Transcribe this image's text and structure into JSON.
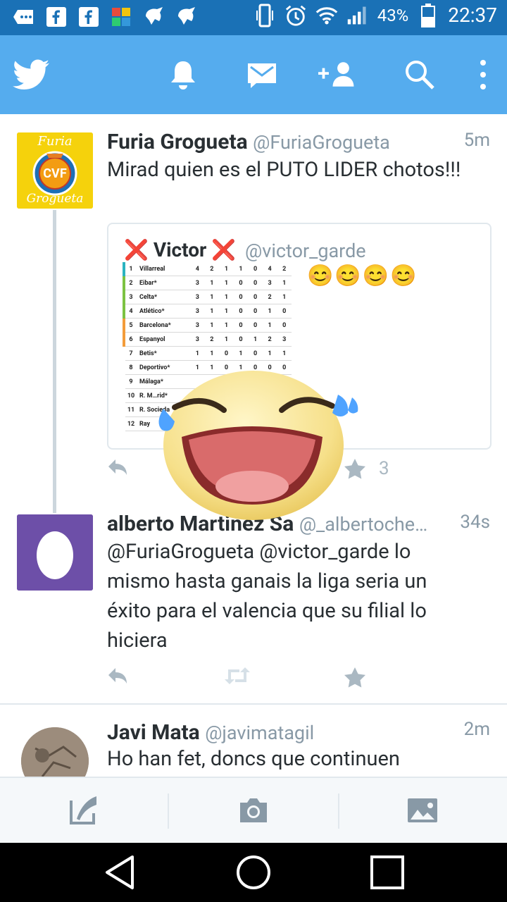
{
  "status_bar": {
    "battery": "43%",
    "time": "22:37"
  },
  "tweets": [
    {
      "name": "Furia Grogueta",
      "handle": "@FuriaGrogueta",
      "time": "5m",
      "text": "Mirad quien es el PUTO LIDER chotos!!!",
      "avatar_text_top": "Furia",
      "avatar_text_bottom": "Grogueta",
      "avatar_badge": "CVF",
      "favorites": "3",
      "quoted": {
        "name": "Victor",
        "handle": "@victor_garde",
        "emojis": "😊😊😊😊",
        "table": [
          {
            "pos": "1",
            "team": "Villarreal",
            "cols": [
              "4",
              "2",
              "1",
              "1",
              "0",
              "4",
              "2"
            ],
            "color": "#2bb3c0"
          },
          {
            "pos": "2",
            "team": "Eibar*",
            "cols": [
              "3",
              "1",
              "1",
              "0",
              "0",
              "3",
              "1"
            ],
            "color": "#7cc242"
          },
          {
            "pos": "3",
            "team": "Celta*",
            "cols": [
              "3",
              "1",
              "1",
              "0",
              "0",
              "2",
              "1"
            ],
            "color": "#7cc242"
          },
          {
            "pos": "4",
            "team": "Atlético*",
            "cols": [
              "3",
              "1",
              "1",
              "0",
              "0",
              "1",
              "0"
            ],
            "color": "#7cc242"
          },
          {
            "pos": "5",
            "team": "Barcelona*",
            "cols": [
              "3",
              "1",
              "1",
              "0",
              "0",
              "1",
              "0"
            ],
            "color": "#f39c3a"
          },
          {
            "pos": "6",
            "team": "Espanyol",
            "cols": [
              "3",
              "2",
              "1",
              "0",
              "1",
              "2",
              "3"
            ],
            "color": "#f39c3a"
          },
          {
            "pos": "7",
            "team": "Betis*",
            "cols": [
              "1",
              "1",
              "0",
              "1",
              "0",
              "1",
              "1"
            ],
            "color": "transparent"
          },
          {
            "pos": "8",
            "team": "Deportivo*",
            "cols": [
              "1",
              "1",
              "0",
              "1",
              "0",
              "0",
              "0"
            ],
            "color": "transparent"
          },
          {
            "pos": "9",
            "team": "Málaga*",
            "cols": [
              "",
              "",
              "",
              "",
              "",
              "",
              ""
            ],
            "color": "transparent"
          },
          {
            "pos": "10",
            "team": "R. M…rid*",
            "cols": [
              "",
              "",
              "",
              "",
              "",
              "",
              ""
            ],
            "color": "transparent"
          },
          {
            "pos": "11",
            "team": "R. Socieda",
            "cols": [
              "",
              "",
              "",
              "",
              "",
              "",
              ""
            ],
            "color": "transparent"
          },
          {
            "pos": "12",
            "team": "Ray",
            "cols": [
              "",
              "",
              "",
              "",
              "",
              "",
              ""
            ],
            "color": "transparent"
          }
        ]
      }
    },
    {
      "name": "alberto Martinez  Sa",
      "handle": "@_albertoche…",
      "time": "34s",
      "text": "@FuriaGrogueta @victor_garde lo mismo hasta ganais la liga seria un éxito para el valencia que su filial lo hiciera"
    },
    {
      "name": "Javi Mata",
      "handle": "@javimatagil",
      "time": "2m",
      "text": "Ho han fet, doncs que continuen"
    }
  ],
  "colors": {
    "twitter_blue": "#55acee",
    "status_bar": "#1a71b6"
  }
}
